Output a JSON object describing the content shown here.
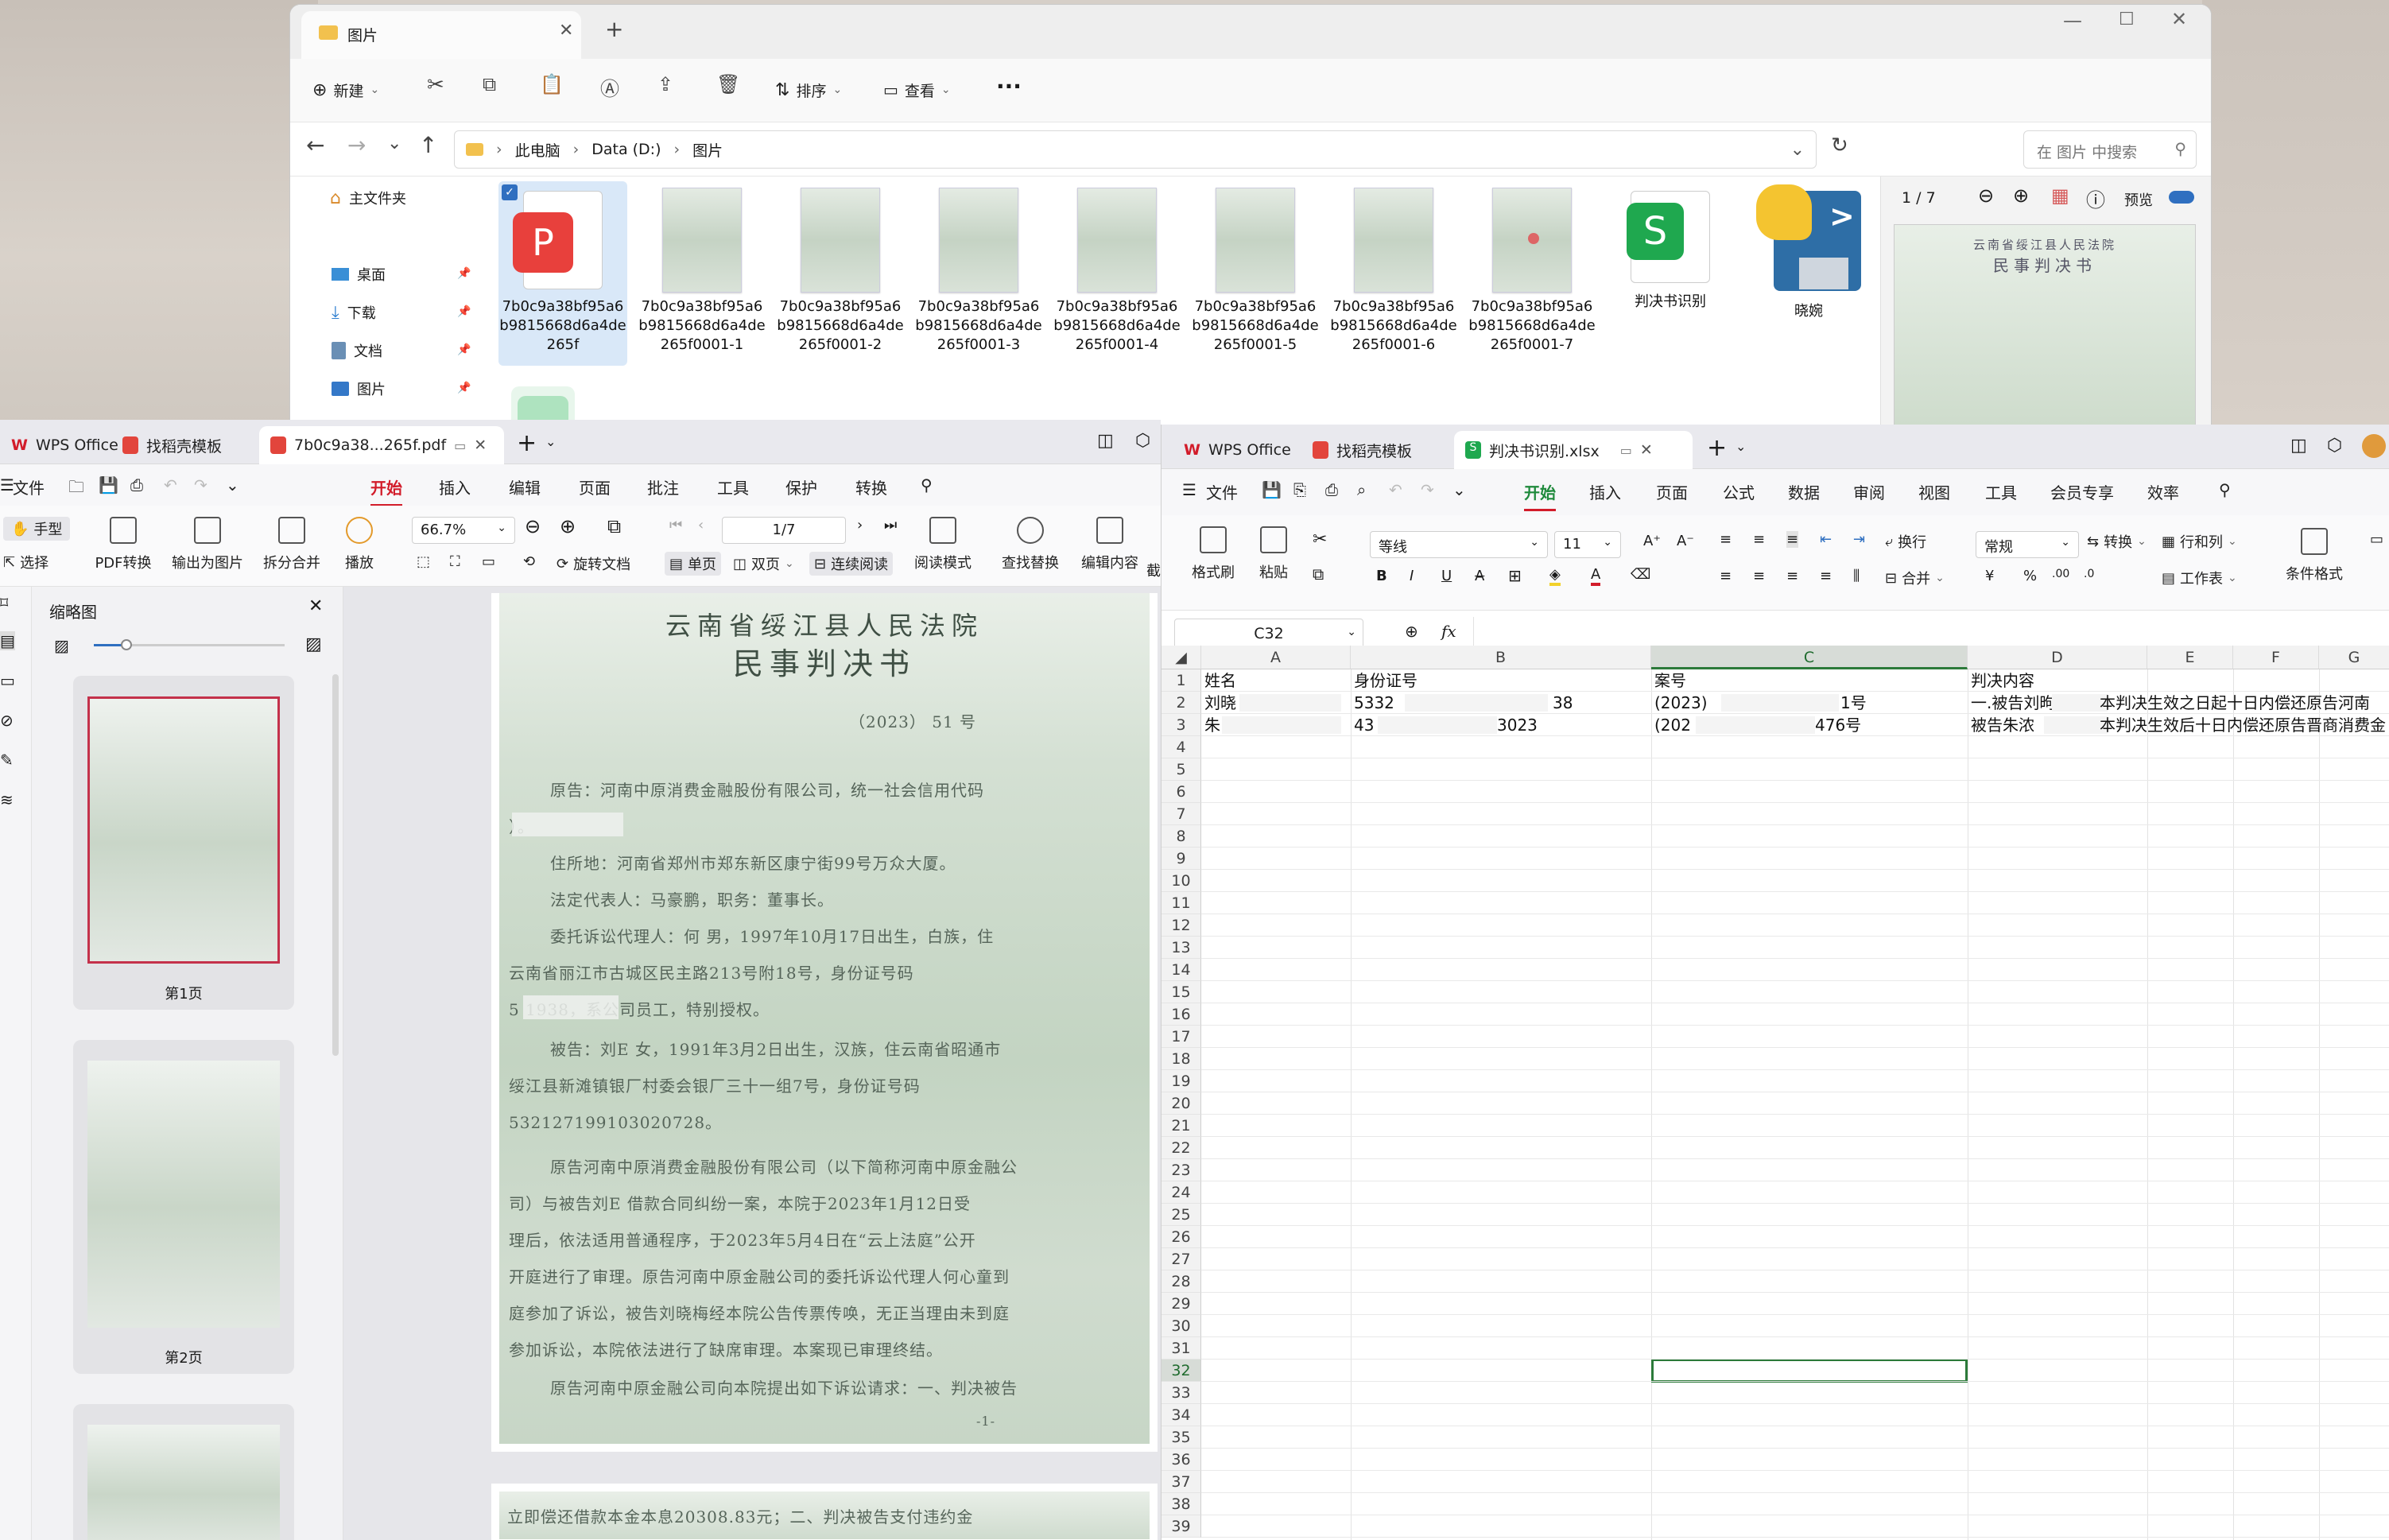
{
  "explorer": {
    "tab_title": "图片",
    "toolbar": {
      "new": "新建",
      "sort": "排序",
      "view": "查看",
      "more": "···"
    },
    "breadcrumb": [
      "此电脑",
      "Data (D:)",
      "图片"
    ],
    "search_placeholder": "在 图片 中搜索",
    "sidebar": [
      {
        "label": "主文件夹"
      },
      {
        "label": "桌面"
      },
      {
        "label": "下载"
      },
      {
        "label": "文档"
      },
      {
        "label": "图片"
      }
    ],
    "files": [
      {
        "name": "7b0c9a38bf95a6b9815668d6a4de265f"
      },
      {
        "name": "7b0c9a38bf95a6b9815668d6a4de265f0001-1"
      },
      {
        "name": "7b0c9a38bf95a6b9815668d6a4de265f0001-2"
      },
      {
        "name": "7b0c9a38bf95a6b9815668d6a4de265f0001-3"
      },
      {
        "name": "7b0c9a38bf95a6b9815668d6a4de265f0001-4"
      },
      {
        "name": "7b0c9a38bf95a6b9815668d6a4de265f0001-5"
      },
      {
        "name": "7b0c9a38bf95a6b9815668d6a4de265f0001-6"
      },
      {
        "name": "7b0c9a38bf95a6b9815668d6a4de265f0001-7"
      },
      {
        "name": "判决书识别"
      },
      {
        "name": "晓婉"
      }
    ],
    "preview": {
      "page": "1 / 7",
      "label": "预览"
    }
  },
  "pdf": {
    "tabs": [
      "WPS Office",
      "找稻壳模板",
      "7b0c9a38...265f.pdf"
    ],
    "file_menu": "文件",
    "menu": [
      "开始",
      "插入",
      "编辑",
      "页面",
      "批注",
      "工具",
      "保护",
      "转换"
    ],
    "ribbon": {
      "hand": "手型",
      "select": "选择",
      "pdf_convert": "PDF转换",
      "to_image": "输出为图片",
      "split_merge": "拆分合并",
      "play": "播放",
      "zoom": "66.7%",
      "page": "1/7",
      "rotate": "旋转文档",
      "single": "单页",
      "double": "双页",
      "continuous": "连续阅读",
      "read_mode": "阅读模式",
      "find_replace": "查找替换",
      "edit_content": "编辑内容",
      "cut": "截"
    },
    "thumb_panel": {
      "title": "缩略图",
      "pages": [
        "第1页",
        "第2页"
      ]
    },
    "doc": {
      "court": "云南省绥江县人民法院",
      "doc_title": "民事判决书",
      "case_no": "（2023）                51 号",
      "lines": [
        "原告：河南中原消费金融股份有限公司，统一社会信用代码",
        "）。",
        "住所地：河南省郑州市郑东新区康宁街99号万众大厦。",
        "法定代表人：马豪鹏，职务：董事长。",
        "委托诉讼代理人：何      男，1997年10月17日出生，白族，住",
        "云南省丽江市古城区民主路213号附18号，身份证号码",
        "5                1938，系公司员工，特别授权。",
        "被告：刘E      女，1991年3月2日出生，汉族，住云南省昭通市",
        "绥江县新滩镇银厂村委会银厂三十一组7号，身份证号码",
        "532127199103020728。",
        "原告河南中原消费金融股份有限公司（以下简称河南中原金融公",
        "司）与被告刘E   借款合同纠纷一案，本院于2023年1月12日受",
        "理后，依法适用普通程序，于2023年5月4日在“云上法庭”公开",
        "开庭进行了审理。原告河南中原金融公司的委托诉讼代理人何心童到",
        "庭参加了诉讼，被告刘晓梅经本院公告传票传唤，无正当理由未到庭",
        "参加诉讼，本院依法进行了缺席审理。本案现已审理终结。",
        "原告河南中原金融公司向本院提出如下诉讼请求：一、判决被告"
      ],
      "page_no": "-1-",
      "page2_line": "立即偿还借款本金本息20308.83元；二、判决被告支付违约金"
    }
  },
  "excel": {
    "tabs": [
      "WPS Office",
      "找稻壳模板",
      "判决书识别.xlsx"
    ],
    "file_menu": "文件",
    "menu": [
      "开始",
      "插入",
      "页面",
      "公式",
      "数据",
      "审阅",
      "视图",
      "工具",
      "会员专享",
      "效率"
    ],
    "ribbon": {
      "format_painter": "格式刷",
      "paste": "粘贴",
      "font": "等线",
      "size": "11",
      "wrap": "换行",
      "merge": "合并",
      "number_format": "常规",
      "convert": "转换",
      "rows_cols": "行和列",
      "worksheet": "工作表",
      "cond_format": "条件格式"
    },
    "name_box": "C32",
    "fx": "fx",
    "columns": [
      "A",
      "B",
      "C",
      "D",
      "E",
      "F",
      "G"
    ],
    "rows": [
      "1",
      "2",
      "3",
      "4",
      "5",
      "6",
      "7",
      "8",
      "9",
      "10",
      "11",
      "12",
      "13",
      "14",
      "15",
      "16",
      "17",
      "18",
      "19",
      "20",
      "21",
      "22",
      "23",
      "24",
      "25",
      "26",
      "27",
      "28",
      "29",
      "30",
      "31",
      "32",
      "33",
      "34",
      "35",
      "36",
      "37",
      "38",
      "39"
    ],
    "cells": {
      "A1": "姓名",
      "B1": "身份证号",
      "C1": "案号",
      "D1": "判决内容",
      "A2": "刘晓",
      "B2": "5332",
      "B2b": "38",
      "C2": "(2023) ",
      "C2b": "1号",
      "D2": "一.被告刘昫",
      "D2b": "本判决生效之日起十日内偿还原告河南",
      "A3": "朱",
      "B3": "43",
      "B3b": "3023",
      "C3": "(202",
      "C3b": "476号",
      "D3": "被告朱浓",
      "D3b": "本判决生效后十日内偿还原告晋商消费金"
    }
  }
}
